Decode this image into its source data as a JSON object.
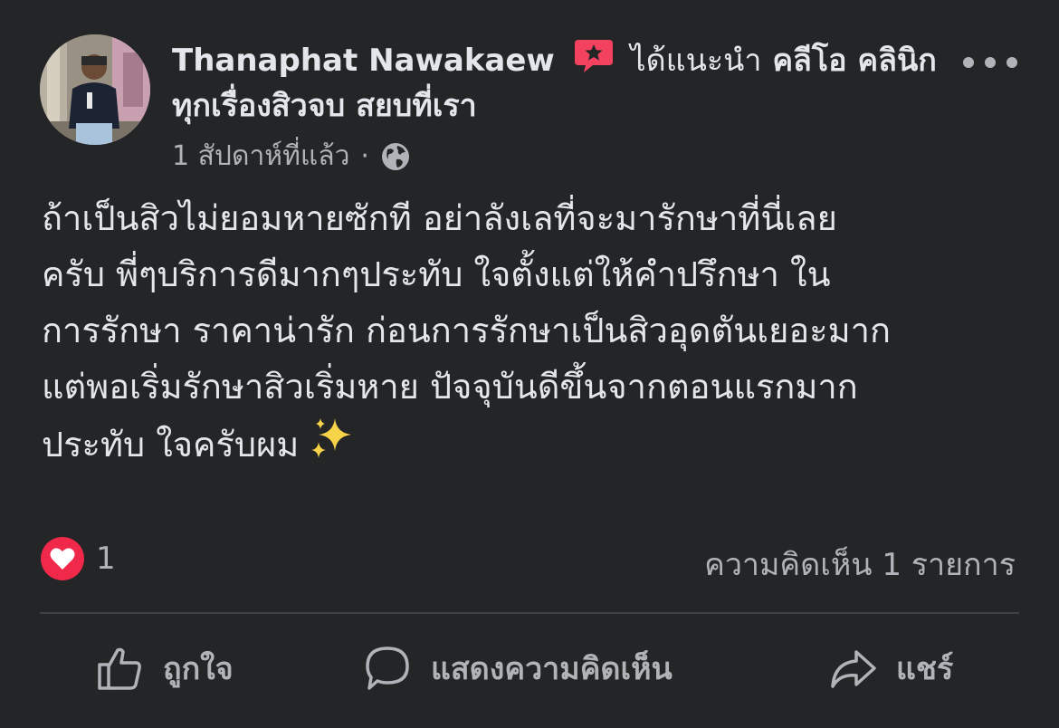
{
  "post": {
    "author_name": "Thanaphat Nawakaew",
    "recommend_label": "ได้แนะนำ",
    "page_name_line1": "คลีโอ คลินิก",
    "page_name_line2": "ทุกเรื่องสิวจบ สยบที่เรา",
    "timestamp": "1 สัปดาห์ที่แล้ว",
    "separator": "·",
    "audience_icon": "globe-icon",
    "more_icon": "more-options-icon",
    "body_lines": [
      "ถ้าเป็นสิวไม่ยอมหายซักที อย่าลังเลที่จะมารักษาที่นี่เลย",
      "ครับ พี่ๆบริการดีมากๆประทับ ใจตั้งแต่ให้คำปรึกษา ใน",
      "การรักษา ราคาน่ารัก ก่อนการรักษาเป็นสิวอุดตันเยอะมาก",
      "แต่พอเริ่มรักษาสิวเริ่มหาย ปัจจุบันดีขึ้นจากตอนแรกมาก",
      "ประทับ ใจครับผม"
    ],
    "body_emoji": "sparkles-icon"
  },
  "reactions": {
    "icon": "love-reaction-icon",
    "count": "1",
    "comments_label": "ความคิดเห็น 1 รายการ"
  },
  "actions": {
    "like_label": "ถูกใจ",
    "comment_label": "แสดงความคิดเห็น",
    "share_label": "แชร์"
  },
  "colors": {
    "background": "#242526",
    "primary_text": "#e4e6eb",
    "secondary_text": "#b0b3b8",
    "recommend_badge": "#f3425f",
    "divider": "#3e4042"
  }
}
